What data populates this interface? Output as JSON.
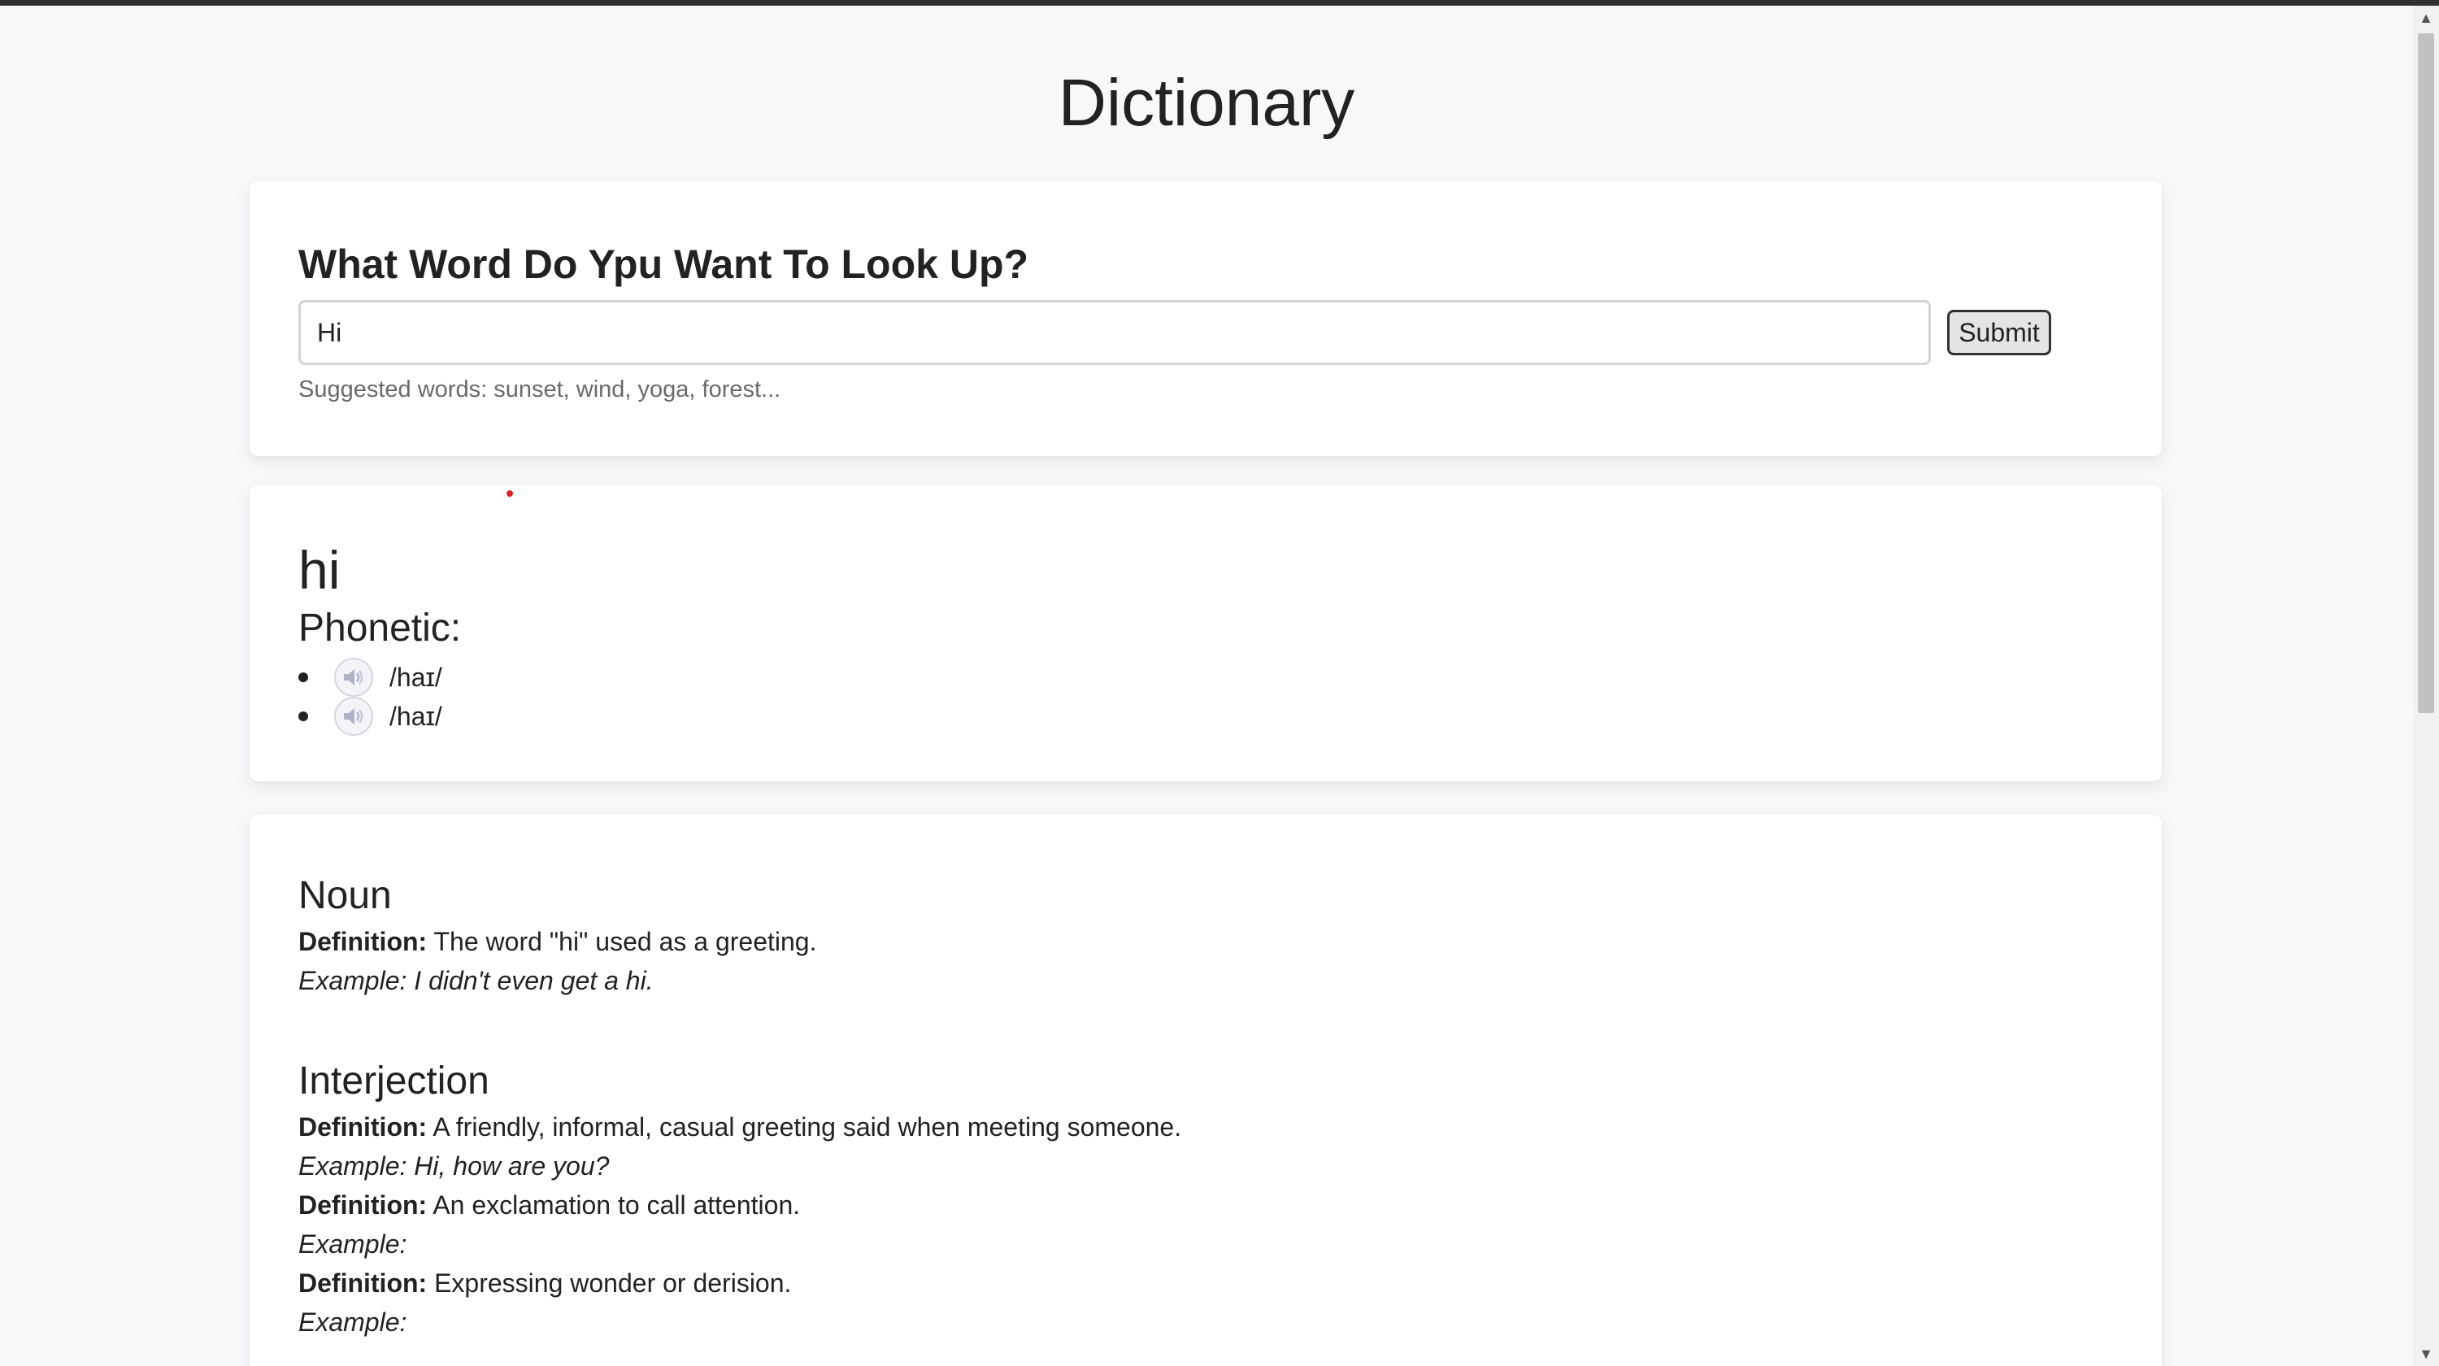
{
  "header": {
    "title": "Dictionary"
  },
  "search": {
    "heading": "What Word Do Ypu Want To Look Up?",
    "value": "Hi",
    "placeholder": "",
    "submit_label": "Submit",
    "suggestions": "Suggested words: sunset, wind, yoga, forest..."
  },
  "word": {
    "title": "hi",
    "phonetic_label": "Phonetic:",
    "phonetics": [
      {
        "text": "/haɪ/",
        "icon": "speaker-icon"
      },
      {
        "text": "/haɪ/",
        "icon": "speaker-icon"
      }
    ]
  },
  "meanings": [
    {
      "part_of_speech": "Noun",
      "definitions": [
        {
          "label": "Definition:",
          "text": " The word \"hi\" used as a greeting.",
          "example": "Example: I didn't even get a hi."
        }
      ]
    },
    {
      "part_of_speech": "Interjection",
      "definitions": [
        {
          "label": "Definition:",
          "text": " A friendly, informal, casual greeting said when meeting someone.",
          "example": "Example: Hi, how are you?"
        },
        {
          "label": "Definition:",
          "text": " An exclamation to call attention.",
          "example": "Example:"
        },
        {
          "label": "Definition:",
          "text": " Expressing wonder or derision.",
          "example": "Example:"
        }
      ]
    }
  ],
  "colors": {
    "background": "#f8f8fb",
    "card": "#ffffff",
    "text": "#222222",
    "muted": "#6a6a6a",
    "cursor_dot": "#e02020"
  },
  "scrollbar": {
    "up_icon": "scroll-up-arrow-icon",
    "down_icon": "scroll-down-arrow-icon"
  }
}
